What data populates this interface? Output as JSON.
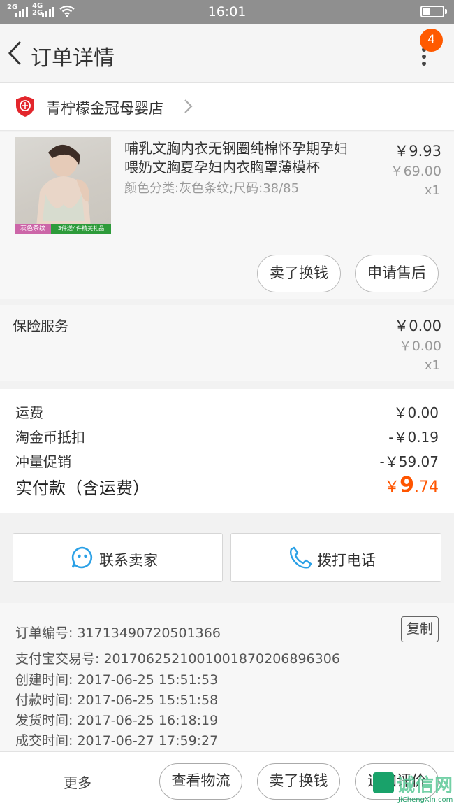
{
  "status_bar": {
    "time": "16:01",
    "network_1": "2G",
    "network_2a": "4G",
    "network_2b": "2G"
  },
  "header": {
    "title": "订单详情",
    "notification_count": "4"
  },
  "shop": {
    "name": "青柠檬金冠母婴店"
  },
  "item": {
    "title": "哺乳文胸内衣无钢圈纯棉怀孕期孕妇喂奶文胸夏孕妇内衣胸罩薄模杯",
    "sku": "颜色分类:灰色条纹;尺码:38/85",
    "price": "￥9.93",
    "original_price": "￥69.00",
    "quantity": "x1",
    "thumb_badge_left": "灰色条纹",
    "thumb_badge_right": "3件送4件精美礼品",
    "sell_button": "卖了换钱",
    "after_sale_button": "申请售后"
  },
  "insurance": {
    "label": "保险服务",
    "price": "￥0.00",
    "original_price": "￥0.00",
    "quantity": "x1"
  },
  "fees": {
    "rows": [
      {
        "label": "运费",
        "value": "￥0.00"
      },
      {
        "label": "淘金币抵扣",
        "value": "-￥0.19"
      },
      {
        "label": "冲量促销",
        "value": "-￥59.07"
      }
    ],
    "total_label": "实付款（含运费）",
    "total_currency": "￥",
    "total_integer": "9",
    "total_decimal": ".74"
  },
  "contact": {
    "seller_label": "联系卖家",
    "call_label": "拨打电话"
  },
  "order_info": {
    "copy_label": "复制",
    "rows": [
      "订单编号: 317134907205013​66",
      "支付宝交易号: 2017062521001001870206896306",
      "创建时间: 2017-06-25 15:51:53",
      "付款时间: 2017-06-25 15:51:58",
      "发货时间: 2017-06-25 16:18:19",
      "成交时间: 2017-06-27 17:59:27"
    ]
  },
  "footer": {
    "more_label": "更多",
    "logistics_label": "查看物流",
    "sell_label": "卖了换钱",
    "review_label": "追加评价"
  },
  "watermark": {
    "text": "诚信网",
    "url": "JiChengXin.com"
  },
  "colors": {
    "accent": "#ff5500",
    "badge": "#ff5a00",
    "status_bar": "#8f8f8f",
    "contact_icon": "#2aa0e6"
  }
}
